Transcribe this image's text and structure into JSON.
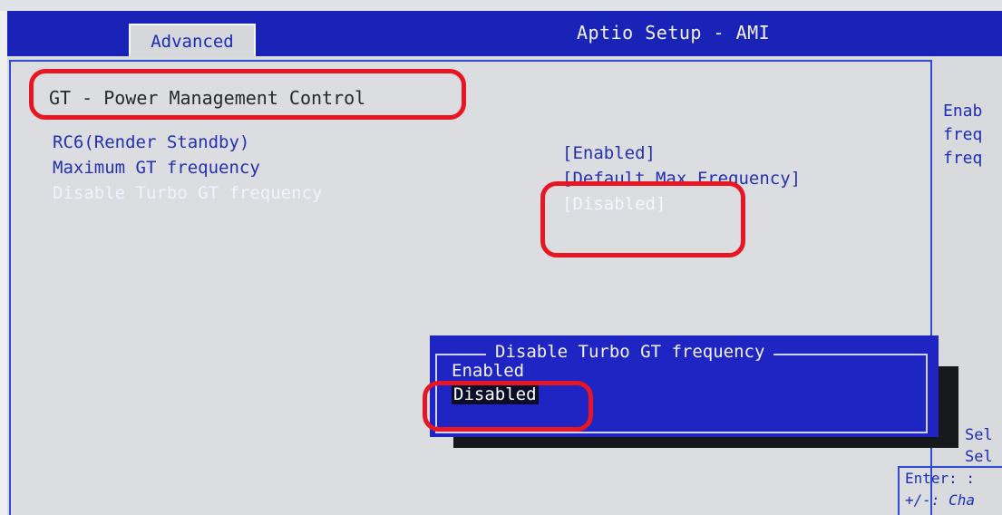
{
  "app_title": "Aptio Setup - AMI",
  "tabs": [
    {
      "label": "Advanced"
    }
  ],
  "page": {
    "section_title": "GT - Power Management Control",
    "items": [
      {
        "label": "RC6(Render Standby)",
        "value": ""
      },
      {
        "label": "Maximum GT frequency",
        "value": "[Enabled]"
      },
      {
        "label": "Disable Turbo GT frequency",
        "value": "[Default Max Frequency]"
      },
      {
        "label": "",
        "value": "[Disabled]"
      }
    ]
  },
  "help": {
    "lines": [
      "Enab",
      "freq",
      "freq"
    ]
  },
  "popup": {
    "title": "Disable Turbo GT frequency",
    "options": [
      "Enabled",
      "Disabled"
    ],
    "selected": "Disabled"
  },
  "key_help": {
    "sel1": "Sel",
    "sel2": "Sel",
    "enter": "Enter: :",
    "change": "+/-: Cha"
  },
  "colors": {
    "bios_blue": "#1e25c2",
    "annotation_red": "#e81622"
  }
}
